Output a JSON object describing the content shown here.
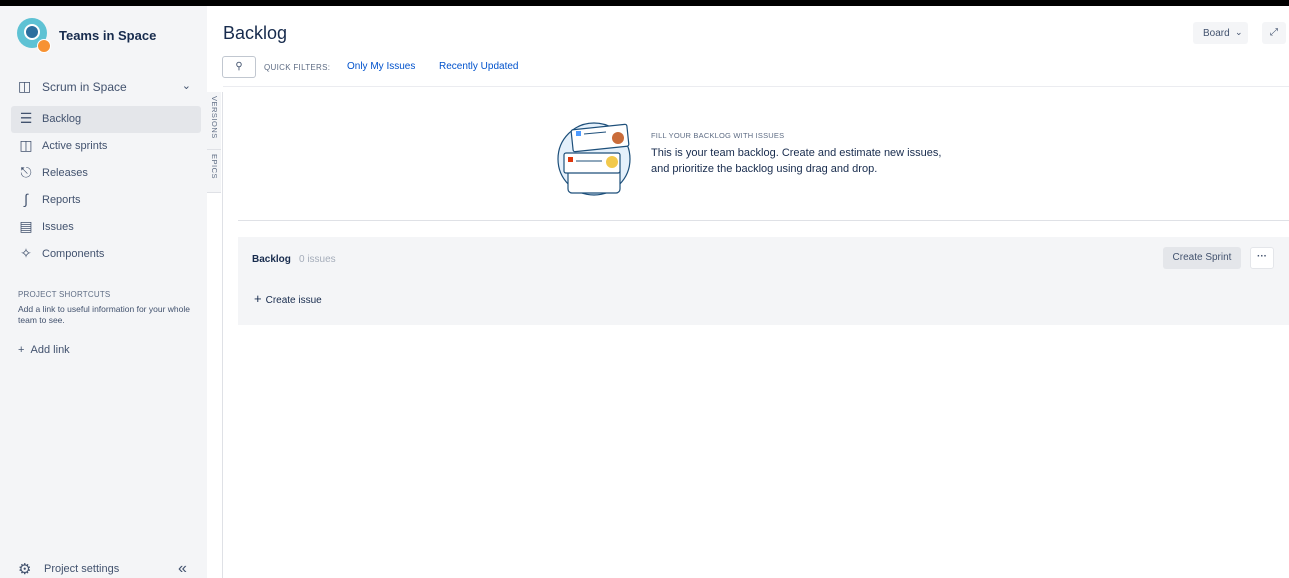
{
  "project": {
    "name": "Teams in Space",
    "board_name": "Scrum in Space"
  },
  "sidebar": {
    "items": [
      {
        "label": "Backlog",
        "icon": "backlog-icon",
        "active": true
      },
      {
        "label": "Active sprints",
        "icon": "board-columns-icon",
        "active": false
      },
      {
        "label": "Releases",
        "icon": "ship-icon",
        "active": false
      },
      {
        "label": "Reports",
        "icon": "chart-line-icon",
        "active": false
      },
      {
        "label": "Issues",
        "icon": "issues-icon",
        "active": false
      },
      {
        "label": "Components",
        "icon": "puzzle-icon",
        "active": false
      }
    ],
    "shortcuts_heading": "PROJECT SHORTCUTS",
    "shortcuts_text": "Add a link to useful information for your whole team to see.",
    "add_link": "Add link",
    "settings_label": "Project settings"
  },
  "vertical_tabs": {
    "versions": "VERSIONS",
    "epics": "EPICS"
  },
  "header": {
    "title": "Backlog",
    "board_button": "Board",
    "quick_filters_label": "QUICK FILTERS:",
    "filters": [
      "Only My Issues",
      "Recently Updated"
    ]
  },
  "empty_state": {
    "heading": "FILL YOUR BACKLOG WITH ISSUES",
    "text": "This is your team backlog. Create and estimate new issues, and prioritize the backlog using drag and drop."
  },
  "backlog_panel": {
    "title": "Backlog",
    "count": "0 issues",
    "create_sprint": "Create Sprint",
    "create_issue": "Create issue"
  },
  "colors": {
    "accent": "#0052cc",
    "sidebar_bg": "#f4f5f7",
    "active_item_bg": "#e4e6ea",
    "text": "#172b4d"
  }
}
